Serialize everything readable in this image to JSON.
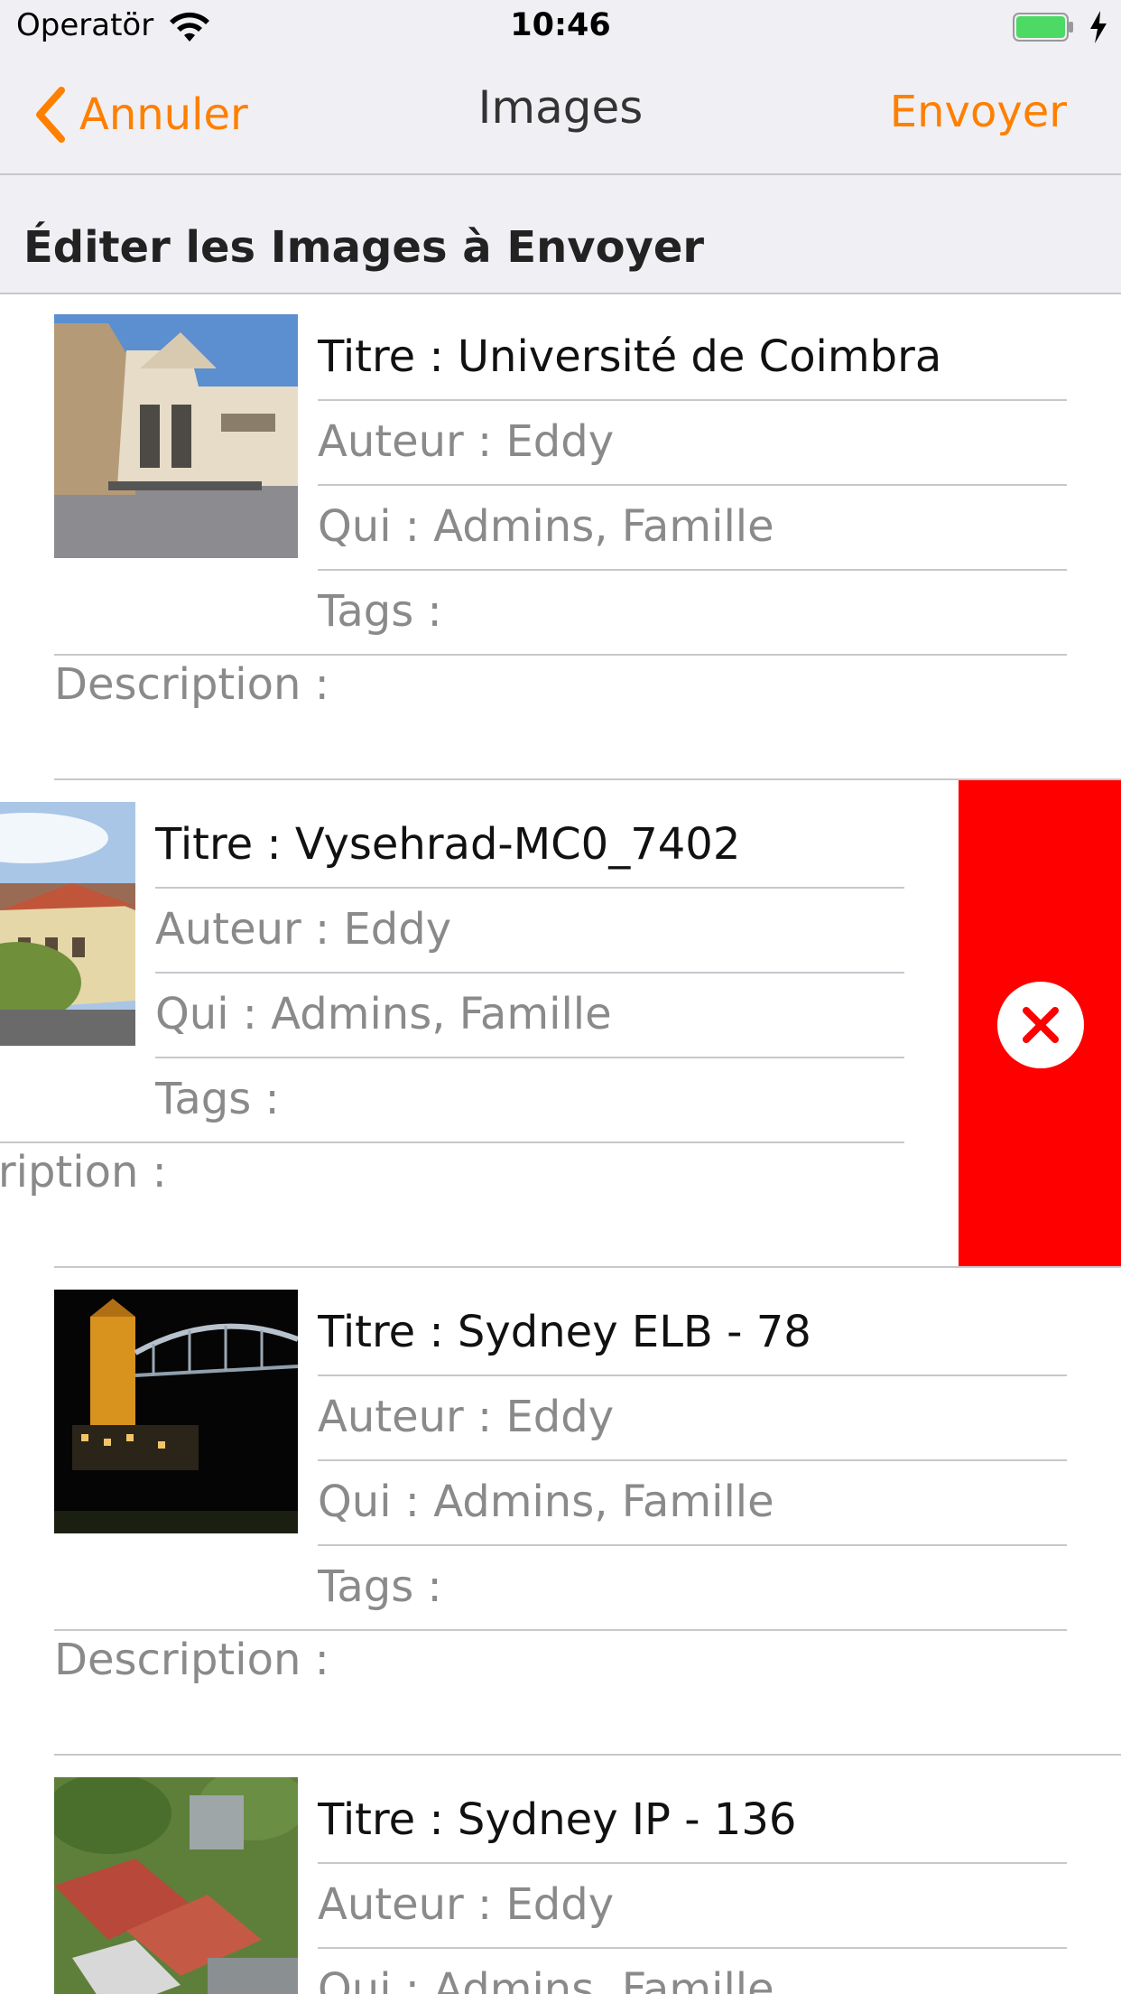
{
  "status_bar": {
    "carrier": "Operatör",
    "time": "10:46",
    "battery_color": "#4cd964"
  },
  "nav": {
    "back_label": "Annuler",
    "title": "Images",
    "send_label": "Envoyer",
    "accent_color": "#ff7f00"
  },
  "section_title": "Éditer les Images à Envoyer",
  "images": [
    {
      "title": "Titre : Université de Coimbra",
      "author": "Auteur : Eddy",
      "who": "Qui : Admins, Famille",
      "tags": "Tags :",
      "description": "Description :"
    },
    {
      "title": "Titre : Vysehrad-MC0_7402",
      "author": "Auteur : Eddy",
      "who": "Qui : Admins, Famille",
      "tags": "Tags :",
      "description": "Description :"
    },
    {
      "title": "Titre : Sydney ELB - 78",
      "author": "Auteur : Eddy",
      "who": "Qui : Admins, Famille",
      "tags": "Tags :",
      "description": "Description :"
    },
    {
      "title": "Titre : Sydney IP - 136",
      "author": "Auteur : Eddy",
      "who": "Qui : Admins, Famille"
    }
  ],
  "delete_action": {
    "icon": "close-circle-icon",
    "color": "#ff0000"
  }
}
